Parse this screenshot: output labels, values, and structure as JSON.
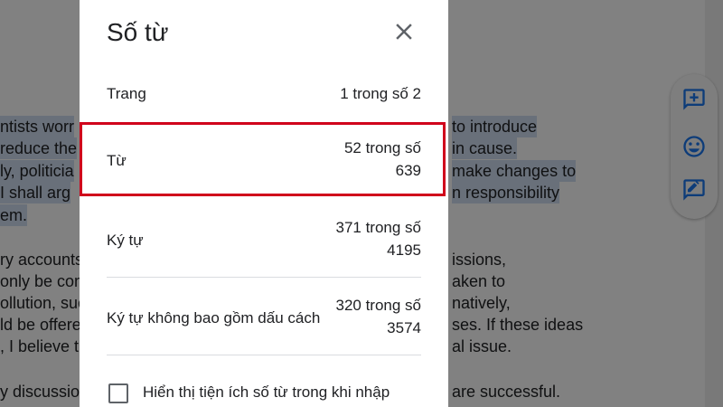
{
  "dialog": {
    "title": "Số từ",
    "rows": [
      {
        "label": "Trang",
        "value": "1 trong số 2"
      },
      {
        "label": "Từ",
        "value_line1": "52 trong số",
        "value_line2": "639"
      },
      {
        "label": "Ký tự",
        "value_line1": "371 trong số",
        "value_line2": "4195"
      },
      {
        "label": "Ký tự không bao gồm dấu cách",
        "value_line1": "320 trong số",
        "value_line2": "3574"
      }
    ],
    "checkbox_label": "Hiển thị tiện ích số từ trong khi nhập",
    "checkbox_checked": false
  },
  "document": {
    "left_fragments": [
      "ntists worr",
      "reduce the",
      "ly, politicia",
      "I shall arg",
      "em.",
      "ry accounts",
      "only be com",
      "ollution, suc",
      "ld be offere",
      ", I believe t",
      "y discussio"
    ],
    "right_fragments": [
      "to introduce",
      "in cause.",
      "make changes to",
      "n responsibility",
      "issions,",
      "aken to",
      "natively,",
      "ses. If these ideas",
      "al issue.",
      "are successful."
    ]
  },
  "side_actions": [
    {
      "icon": "add-comment-icon"
    },
    {
      "icon": "emoji-reaction-icon"
    },
    {
      "icon": "suggest-edit-icon"
    }
  ],
  "colors": {
    "highlight_border": "#d0021b",
    "side_icon": "#1a73e8"
  }
}
